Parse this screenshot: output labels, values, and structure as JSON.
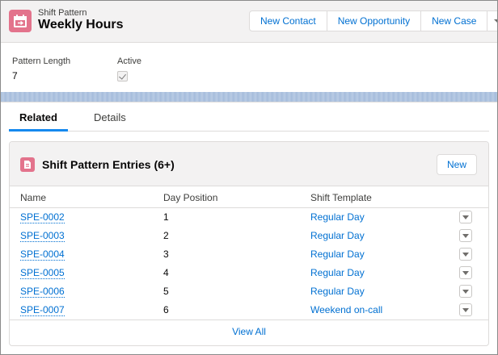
{
  "header": {
    "object_type": "Shift Pattern",
    "title": "Weekly Hours",
    "actions": [
      "New Contact",
      "New Opportunity",
      "New Case"
    ]
  },
  "fields": {
    "pattern_length_label": "Pattern Length",
    "pattern_length_value": "7",
    "active_label": "Active",
    "active_checked": true
  },
  "tabs": {
    "related": "Related",
    "details": "Details",
    "selected": "Related"
  },
  "related_list": {
    "title": "Shift Pattern Entries (6+)",
    "new_label": "New",
    "columns": [
      "Name",
      "Day Position",
      "Shift Template"
    ],
    "rows": [
      {
        "name": "SPE-0002",
        "day": "1",
        "template": "Regular Day"
      },
      {
        "name": "SPE-0003",
        "day": "2",
        "template": "Regular Day"
      },
      {
        "name": "SPE-0004",
        "day": "3",
        "template": "Regular Day"
      },
      {
        "name": "SPE-0005",
        "day": "4",
        "template": "Regular Day"
      },
      {
        "name": "SPE-0006",
        "day": "5",
        "template": "Regular Day"
      },
      {
        "name": "SPE-0007",
        "day": "6",
        "template": "Weekend on-call"
      }
    ],
    "view_all": "View All"
  },
  "colors": {
    "icon_pink": "#e3738c",
    "link_blue": "#0070d2",
    "tab_accent": "#1589ee"
  }
}
